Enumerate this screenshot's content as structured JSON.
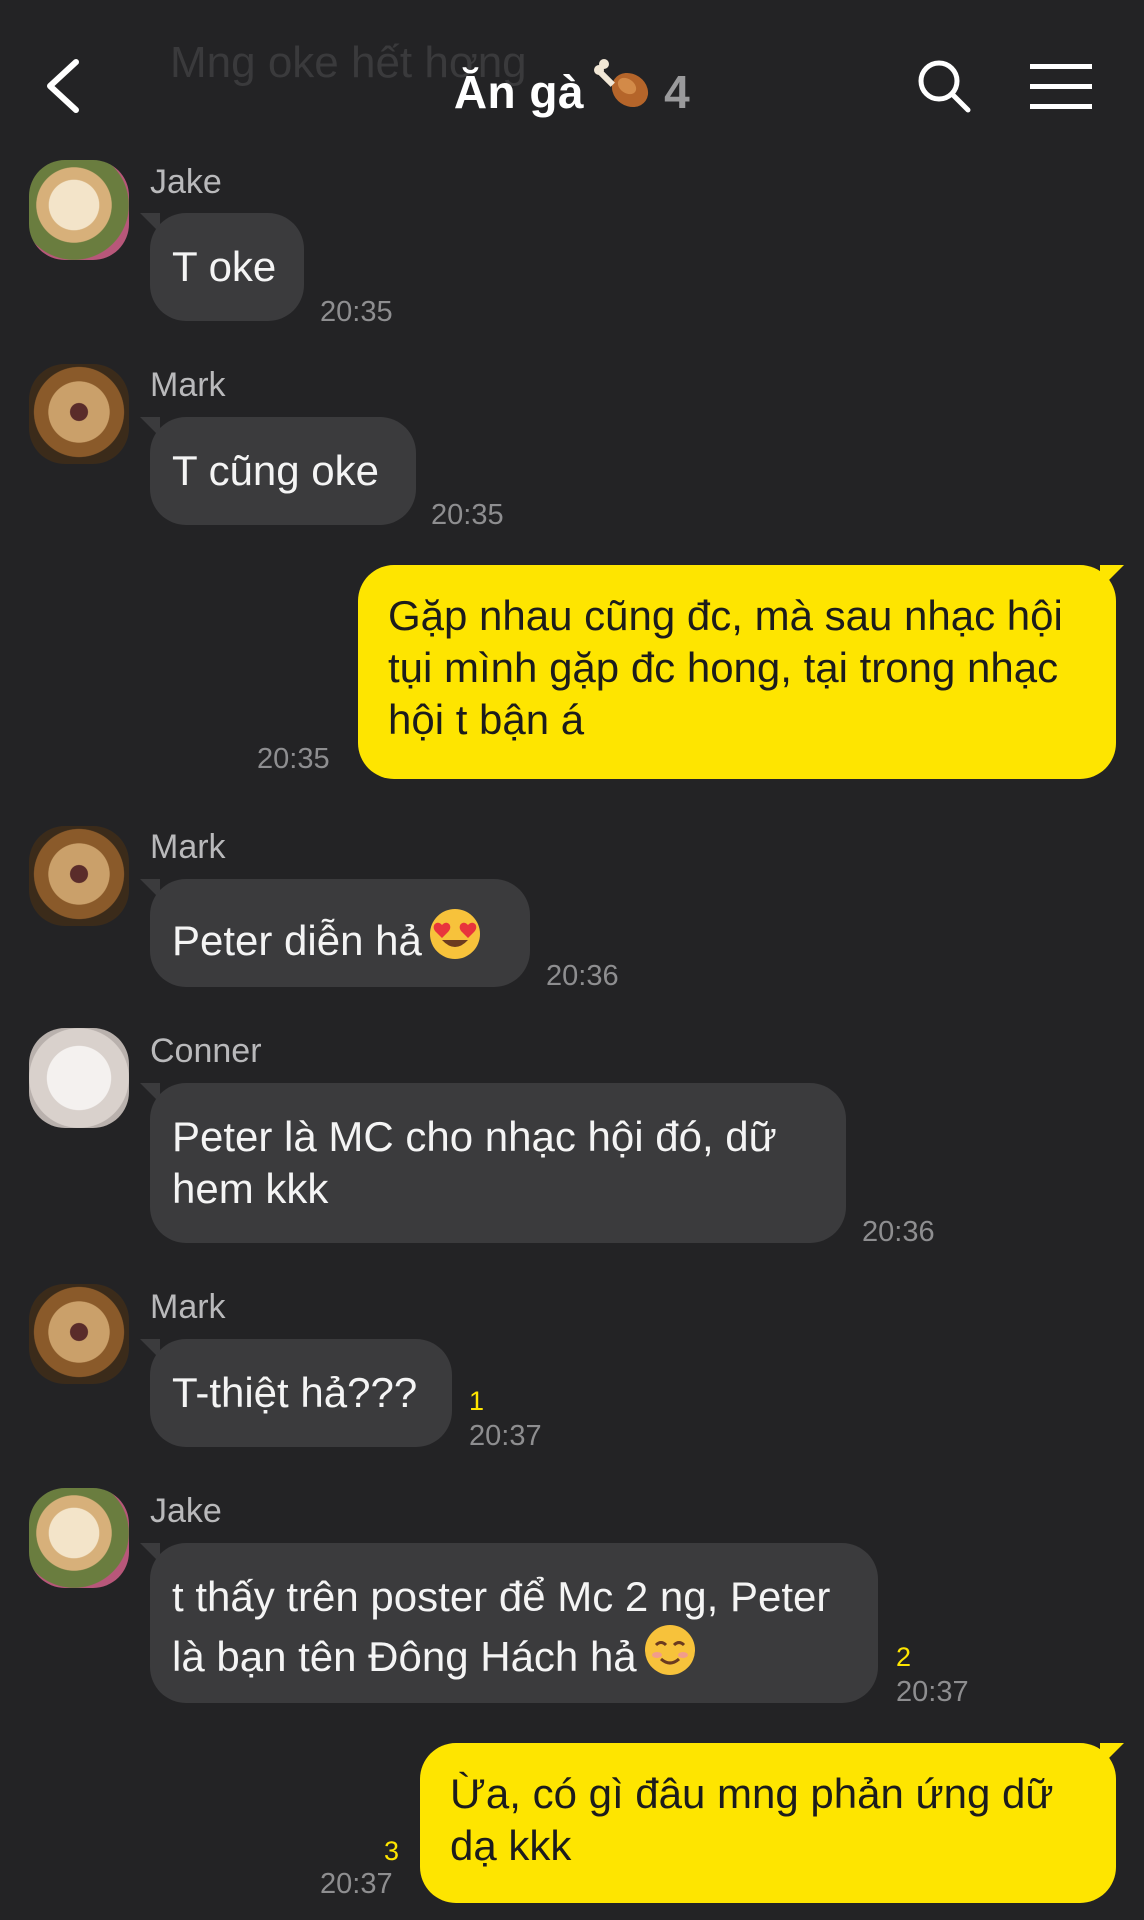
{
  "header": {
    "ghost_text": "Mng oke hết hơng",
    "title": "Ăn gà",
    "member_count": "4",
    "icons": [
      "back-arrow-icon",
      "drumstick-icon",
      "search-icon",
      "menu-icon"
    ]
  },
  "colors": {
    "background": "#232325",
    "incoming_bubble": "#3b3b3d",
    "outgoing_bubble": "#fee500",
    "unread": "#fee500"
  },
  "messages": [
    {
      "sender": "Jake",
      "text": "T oke",
      "time": "20:35"
    },
    {
      "sender": "Mark",
      "text": "T cũng oke",
      "time": "20:35"
    },
    {
      "sender": "me",
      "text": "Gặp nhau cũng đc, mà sau nhạc hội tụi mình gặp đc hong, tại trong nhạc hội t bận á",
      "time": "20:35"
    },
    {
      "sender": "Mark",
      "text": "Peter diễn hả",
      "time": "20:36",
      "emoji": "heart-eyes-emoji"
    },
    {
      "sender": "Conner",
      "text": "Peter là MC cho nhạc hội đó, dữ hem kkk",
      "time": "20:36"
    },
    {
      "sender": "Mark",
      "text": "T-thiệt hả???",
      "time": "20:37",
      "unread": "1"
    },
    {
      "sender": "Jake",
      "text": "t thấy trên poster để Mc 2 ng, Peter là bạn tên Đông Hách hả",
      "time": "20:37",
      "unread": "2",
      "emoji": "smiling-emoji"
    },
    {
      "sender": "me",
      "text": "Ừa, có gì đâu mng phản ứng dữ dạ kkk",
      "time": "20:37",
      "unread": "3"
    }
  ]
}
